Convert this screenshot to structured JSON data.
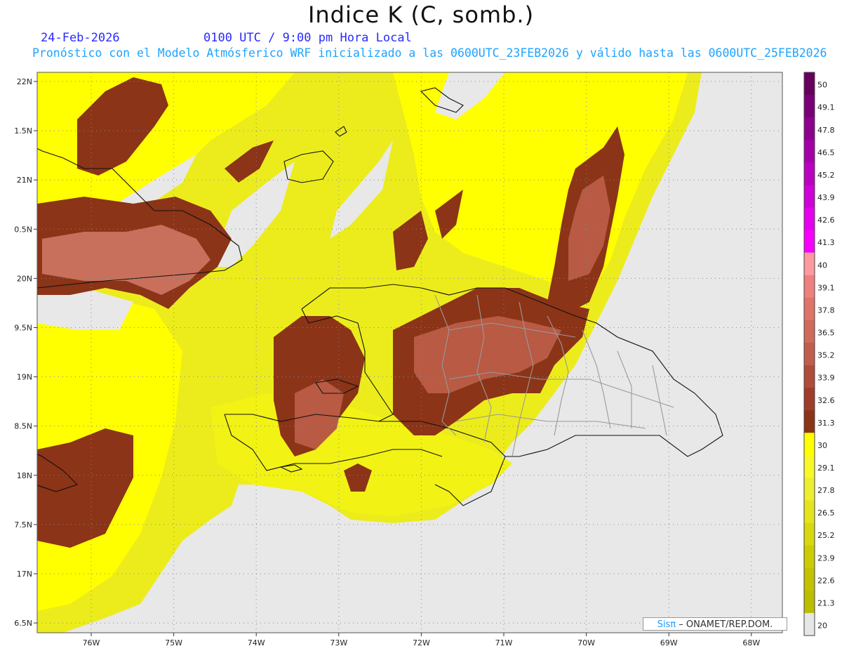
{
  "header": {
    "title": "Indice K (C, somb.)",
    "date": "24-Feb-2026",
    "valid_time": "0100 UTC / 9:00 pm Hora Local",
    "forecast_line": "Pronóstico con el Modelo Atmósferico WRF inicializado a las 0600UTC_23FEB2026 y válido hasta las  0600UTC_25FEB2026"
  },
  "map": {
    "lat_labels": [
      "22N",
      "1.5N",
      "21N",
      "0.5N",
      "20N",
      "9.5N",
      "19N",
      "8.5N",
      "18N",
      "7.5N",
      "17N",
      "6.5N"
    ],
    "lon_labels": [
      "76W",
      "75W",
      "74W",
      "73W",
      "72W",
      "71W",
      "70W",
      "69W",
      "68W"
    ],
    "lon_values": [
      -76,
      -75,
      -74,
      -73,
      -72,
      -71,
      -70,
      -69,
      -68
    ],
    "lat_values": [
      22,
      21.5,
      21,
      20.5,
      20,
      19.5,
      19,
      18.5,
      18,
      17.5,
      17,
      16.5
    ],
    "colors": {
      "background_no_data": "#e8e8e8",
      "yellow_bright": "#ffff00",
      "yellow_mid": "#ecec1c",
      "brown_dark": "#8b3417",
      "brown_mid": "#a84a30",
      "salmon": "#c8705c",
      "coast": "#111111",
      "border": "#999999"
    }
  },
  "colorbar": {
    "labels": [
      "50",
      "49.1",
      "47.8",
      "46.5",
      "45.2",
      "43.9",
      "42.6",
      "41.3",
      "40",
      "39.1",
      "37.8",
      "36.5",
      "35.2",
      "33.9",
      "32.6",
      "31.3",
      "30",
      "29.1",
      "27.8",
      "26.5",
      "25.2",
      "23.9",
      "22.6",
      "21.3",
      "20"
    ],
    "colors": [
      "#66005c",
      "#7a0077",
      "#8e008e",
      "#a400a8",
      "#ba00c0",
      "#cf00d8",
      "#e400ef",
      "#f700ff",
      "#ff99a0",
      "#f08080",
      "#e07468",
      "#d06b5c",
      "#c05e4e",
      "#b04c3a",
      "#a03c2a",
      "#8b3417",
      "#ffff00",
      "#f8f828",
      "#eeee30",
      "#e4e41c",
      "#d8d80c",
      "#cccc00",
      "#c2c200",
      "#bdbd00",
      "#e6e6e6"
    ]
  },
  "credit": {
    "sis": "Sisπ",
    "org": " – ONAMET/REP.DOM."
  }
}
